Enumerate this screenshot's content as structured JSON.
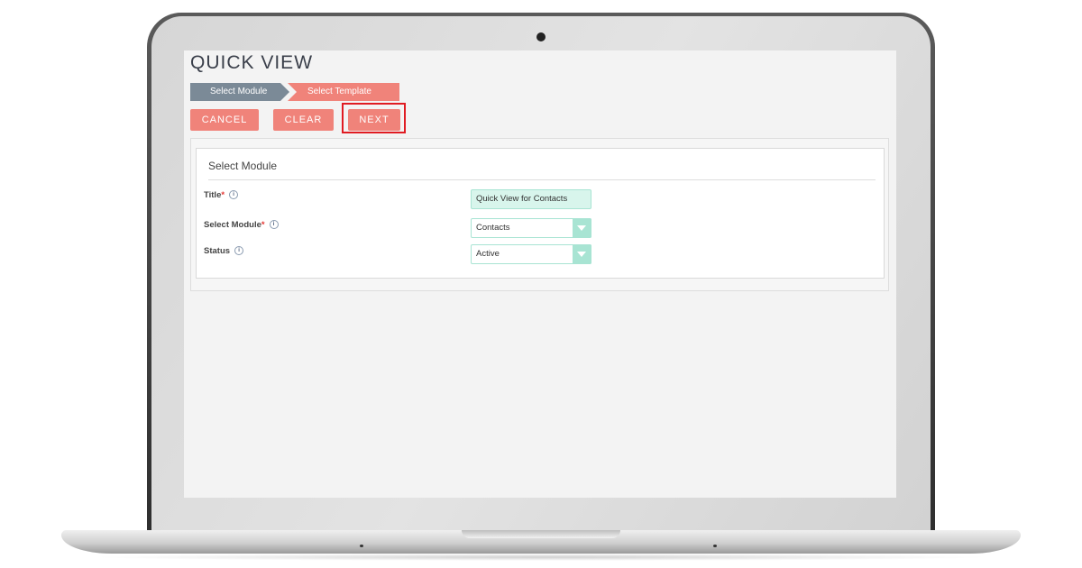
{
  "page": {
    "title": "QUICK VIEW"
  },
  "wizard": {
    "steps": [
      {
        "label": "Select Module",
        "state": "inactive"
      },
      {
        "label": "Select Template",
        "state": "active"
      }
    ]
  },
  "toolbar": {
    "cancel_label": "CANCEL",
    "clear_label": "CLEAR",
    "next_label": "NEXT",
    "highlighted": "NEXT"
  },
  "form": {
    "section_title": "Select Module",
    "fields": [
      {
        "label": "Title",
        "required": true,
        "required_mark": "*",
        "info_icon": "info-icon",
        "type": "text",
        "value": "Quick View for Contacts"
      },
      {
        "label": "Select Module",
        "required": true,
        "required_mark": "*",
        "info_icon": "info-icon",
        "type": "select",
        "value": "Contacts"
      },
      {
        "label": "Status",
        "required": false,
        "info_icon": "info-icon",
        "type": "select",
        "value": "Active"
      }
    ]
  },
  "colors": {
    "accent": "#f0837a",
    "step_inactive": "#7b8a97",
    "field_border": "#a8e4d3",
    "field_fill": "#d8f5ec",
    "highlight": "#e01b22"
  }
}
